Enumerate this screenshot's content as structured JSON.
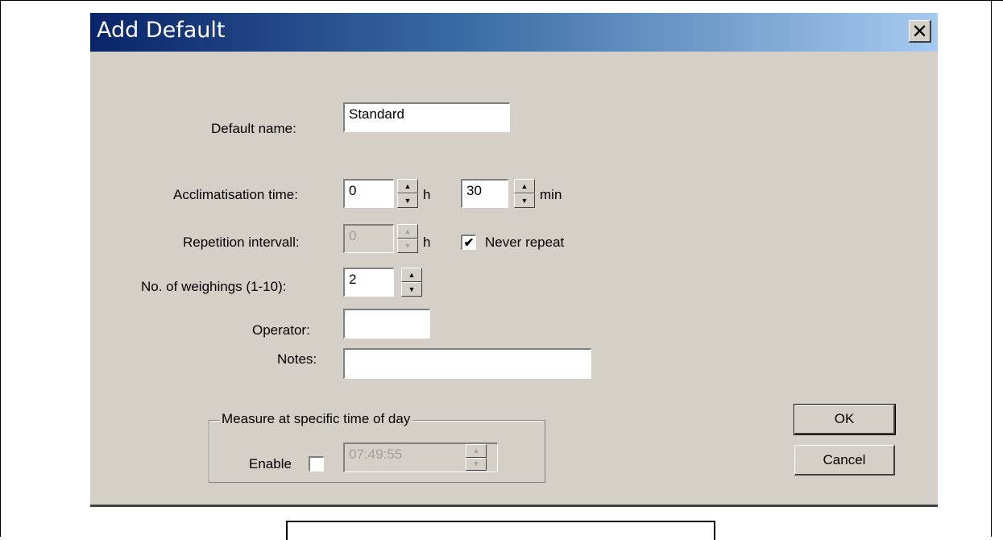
{
  "dialog": {
    "title": "Add Default",
    "close_glyph": "✕"
  },
  "form": {
    "default_name": {
      "label": "Default name:",
      "value": "Standard"
    },
    "acclimatisation": {
      "label": "Acclimatisation time:",
      "hours_value": "0",
      "hours_unit": "h",
      "minutes_value": "30",
      "minutes_unit": "min"
    },
    "repetition": {
      "label": "Repetition intervall:",
      "value": "0",
      "unit": "h",
      "never_repeat_label": "Never repeat",
      "never_repeat_checked": true
    },
    "weighings": {
      "label": "No. of weighings (1-10):",
      "value": "2"
    },
    "operator": {
      "label": "Operator:",
      "value": ""
    },
    "notes": {
      "label": "Notes:",
      "value": ""
    }
  },
  "time_of_day": {
    "group_title": "Measure at specific time of day",
    "enable_label": "Enable",
    "enable_checked": false,
    "time_value": "07:49:55"
  },
  "buttons": {
    "ok": "OK",
    "cancel": "Cancel"
  },
  "icons": {
    "spin_up": "▲",
    "spin_down": "▼",
    "check": "✔"
  },
  "colors": {
    "title_start": "#0a246a",
    "title_end": "#a6caf0",
    "face": "#d4d0c8"
  }
}
